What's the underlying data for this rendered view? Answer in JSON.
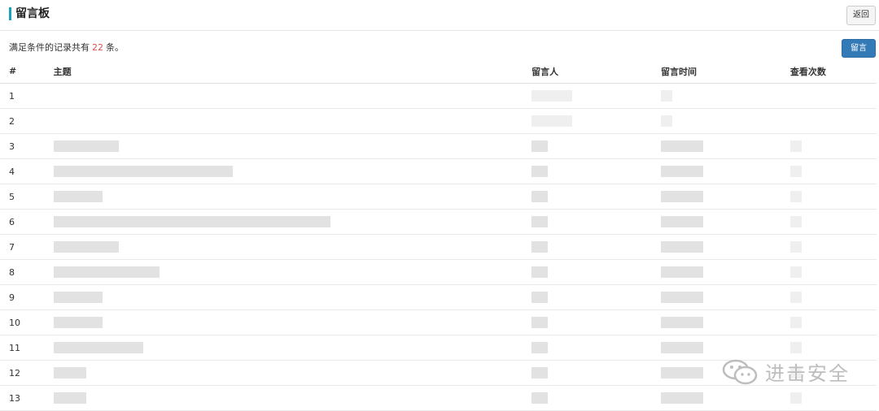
{
  "header": {
    "title": "留言板",
    "back_label": "返回"
  },
  "summary": {
    "prefix": "满足条件的记录共有",
    "count": "22",
    "suffix": "条。"
  },
  "toolbar": {
    "post_label": "留言"
  },
  "table": {
    "headers": {
      "index": "#",
      "subject": "主题",
      "author": "留言人",
      "time": "留言时间",
      "views": "查看次数"
    },
    "rows": [
      {
        "index": "1"
      },
      {
        "index": "2"
      },
      {
        "index": "3"
      },
      {
        "index": "4"
      },
      {
        "index": "5"
      },
      {
        "index": "6"
      },
      {
        "index": "7"
      },
      {
        "index": "8"
      },
      {
        "index": "9"
      },
      {
        "index": "10"
      },
      {
        "index": "11"
      },
      {
        "index": "12"
      },
      {
        "index": "13"
      }
    ]
  },
  "watermark": {
    "text": "进击安全",
    "icon": "wechat-icon"
  }
}
